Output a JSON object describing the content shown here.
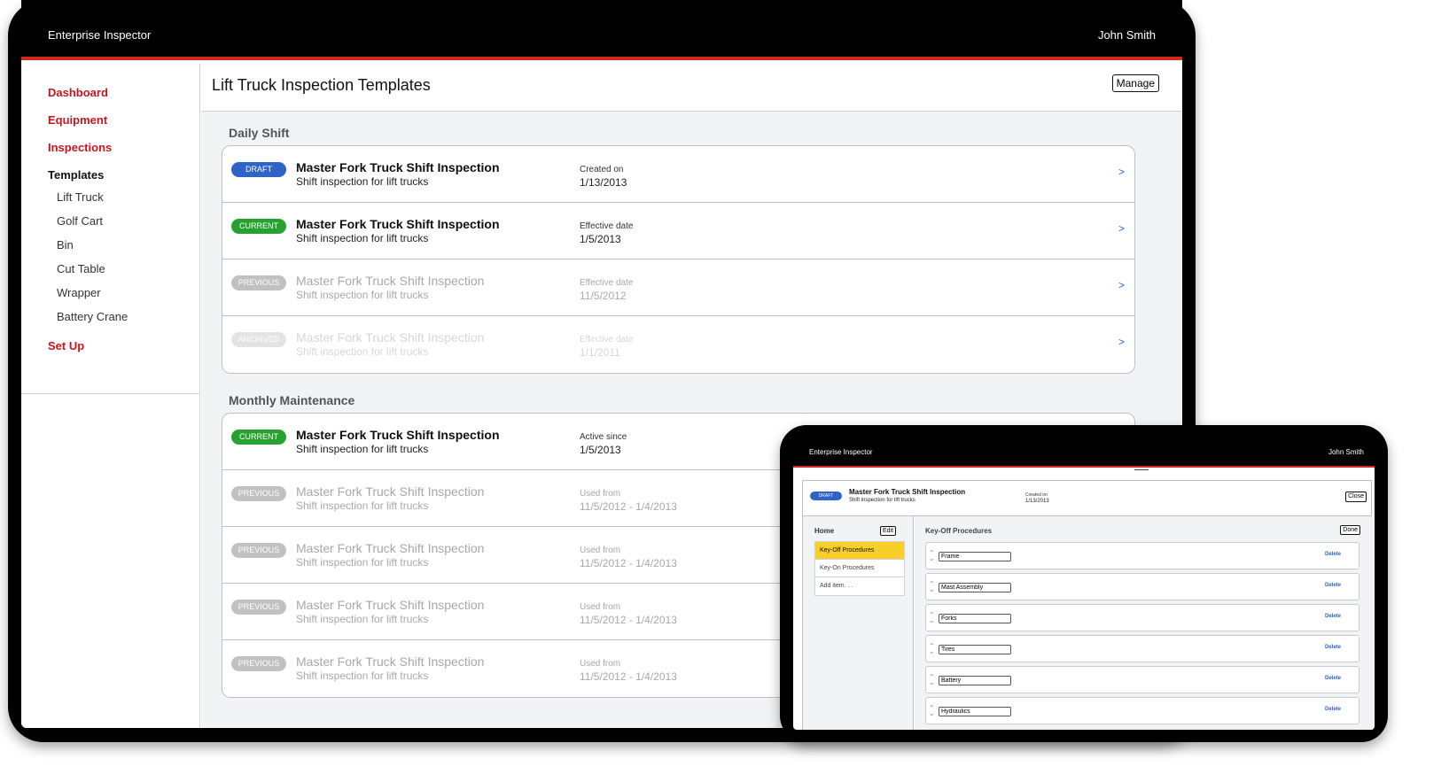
{
  "large_device": {
    "app_title": "Enterprise Inspector",
    "user_name": "John Smith",
    "sidebar": {
      "nav": [
        {
          "label": "Dashboard"
        },
        {
          "label": "Equipment"
        },
        {
          "label": "Inspections"
        },
        {
          "label": "Templates"
        },
        {
          "label": "Set Up"
        }
      ],
      "template_subitems": [
        "Lift Truck",
        "Golf Cart",
        "Bin",
        "Cut Table",
        "Wrapper",
        "Battery Crane"
      ]
    },
    "page_title": "Lift Truck Inspection Templates",
    "manage_label": "Manage",
    "sections": [
      {
        "title": "Daily Shift",
        "rows": [
          {
            "status": "DRAFT",
            "name": "Master Fork Truck Shift Inspection",
            "desc": "Shift inspection for lift trucks",
            "date_label": "Created on",
            "date_value": "1/13/2013"
          },
          {
            "status": "CURRENT",
            "name": "Master Fork Truck Shift Inspection",
            "desc": "Shift inspection for lift trucks",
            "date_label": "Effective date",
            "date_value": "1/5/2013"
          },
          {
            "status": "PREVIOUS",
            "name": "Master Fork Truck Shift Inspection",
            "desc": "Shift inspection for lift trucks",
            "date_label": "Effective date",
            "date_value": "11/5/2012"
          },
          {
            "status": "ARCHIVED",
            "name": "Master Fork Truck Shift Inspection",
            "desc": "Shift inspection for lift trucks",
            "date_label": "Effective date",
            "date_value": "1/1/2011"
          }
        ]
      },
      {
        "title": "Monthly Maintenance",
        "rows": [
          {
            "status": "CURRENT",
            "name": "Master Fork Truck Shift Inspection",
            "desc": "Shift inspection for lift trucks",
            "date_label": "Active since",
            "date_value": "1/5/2013"
          },
          {
            "status": "PREVIOUS",
            "name": "Master Fork Truck Shift Inspection",
            "desc": "Shift inspection for lift trucks",
            "date_label": "Used from",
            "date_value": "11/5/2012 - 1/4/2013"
          },
          {
            "status": "PREVIOUS",
            "name": "Master Fork Truck Shift Inspection",
            "desc": "Shift inspection for lift trucks",
            "date_label": "Used from",
            "date_value": "11/5/2012 - 1/4/2013"
          },
          {
            "status": "PREVIOUS",
            "name": "Master Fork Truck Shift Inspection",
            "desc": "Shift inspection for lift trucks",
            "date_label": "Used from",
            "date_value": "11/5/2012 - 1/4/2013"
          },
          {
            "status": "PREVIOUS",
            "name": "Master Fork Truck Shift Inspection",
            "desc": "Shift inspection for lift trucks",
            "date_label": "Used from",
            "date_value": "11/5/2012 - 1/4/2013"
          }
        ]
      }
    ],
    "chevron": ">"
  },
  "small_device": {
    "app_title": "Enterprise Inspector",
    "user_name": "John Smith",
    "template": {
      "status": "DRAFT",
      "name": "Master Fork Truck Shift Inspection",
      "desc": "Shift inspection for lift trucks",
      "date_label": "Created on",
      "date_value": "1/13/2013"
    },
    "close_label": "Close",
    "left_panel": {
      "title": "Home",
      "edit_label": "Edit",
      "items": [
        "Key-Off Procedures",
        "Key-On Procedures",
        "Add item. . ."
      ]
    },
    "right_panel": {
      "title": "Key-Off Procedures",
      "done_label": "Done",
      "procedures": [
        "Frame",
        "Mast Assembly",
        "Forks",
        "Tires",
        "Battery",
        "Hydraulics"
      ],
      "delete_label": "Delete"
    }
  },
  "colors": {
    "brand_red": "#d42a1d",
    "nav_red": "#c8161d",
    "draft_blue": "#2e63c8",
    "current_green": "#27a12f",
    "previous_gray": "#c1c1c1",
    "selected_yellow": "#f8cf28"
  }
}
